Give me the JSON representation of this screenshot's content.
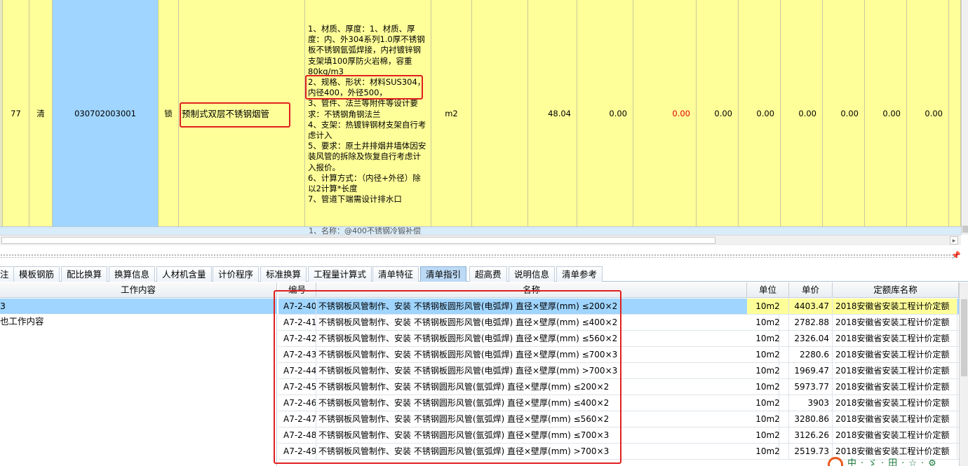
{
  "top_row": {
    "seq": "77",
    "type": "清",
    "code": "030702003001",
    "lock": "锁",
    "name": "预制式双层不锈钢烟管",
    "description": "1、材质、厚度：1、材质、厚度：内、外304系列1.0厚不锈钢板不锈钢氩弧焊接，内衬镀锌钢支架填100厚防火岩棉，容重80kg/m3\n2、规格、形状：材料SUS304，内径400，外径500，\n3、管件、法兰等附件等设计要求：不锈钢角钢法兰\n4、支架：热镀锌钢材支架自行考虑计入\n5、要求：原土井排烟井墙体因安装风管的拆除及恢复自行考虑计入报价。\n6、计算方式：（内径+外径）除以2计算*长度\n7、管道下端需设计排水口",
    "unit": "m2",
    "quantity": "48.04",
    "values": [
      "0.00",
      "0.00",
      "0.00",
      "0.00",
      "0.00",
      "0.00",
      "0.00",
      "0.00"
    ],
    "red_value_color": "#e00000"
  },
  "next_row_peek": "1、名称：@400不锈钢冷锻补偿",
  "tabs": [
    "注",
    "模板钢筋",
    "配比换算",
    "换算信息",
    "人材机含量",
    "计价程序",
    "标准换算",
    "工程量计算式",
    "清单特征",
    "清单指引",
    "超高费",
    "说明信息",
    "清单参考"
  ],
  "active_tab": "清单指引",
  "work_content": {
    "header": "工作内容",
    "rows": [
      "3",
      "也工作内容"
    ]
  },
  "quota_table": {
    "headers": {
      "code": "编号",
      "name": "名称",
      "unit": "单位",
      "price": "单价",
      "lib": "定额库名称"
    },
    "rows": [
      {
        "code": "A7-2-40",
        "name": "不锈钢板风管制作、安装 不锈钢板圆形风管(电弧焊) 直径×壁厚(mm) ≤200×2",
        "unit": "10m2",
        "price": "4403.47",
        "lib": "2018安徽省安装工程计价定额"
      },
      {
        "code": "A7-2-41",
        "name": "不锈钢板风管制作、安装 不锈钢板圆形风管(电弧焊) 直径×壁厚(mm) ≤400×2",
        "unit": "10m2",
        "price": "2782.88",
        "lib": "2018安徽省安装工程计价定额"
      },
      {
        "code": "A7-2-42",
        "name": "不锈钢板风管制作、安装 不锈钢板圆形风管(电弧焊) 直径×壁厚(mm) ≤560×2",
        "unit": "10m2",
        "price": "2326.04",
        "lib": "2018安徽省安装工程计价定额"
      },
      {
        "code": "A7-2-43",
        "name": "不锈钢板风管制作、安装 不锈钢板圆形风管(电弧焊) 直径×壁厚(mm) ≤700×3",
        "unit": "10m2",
        "price": "2280.6",
        "lib": "2018安徽省安装工程计价定额"
      },
      {
        "code": "A7-2-44",
        "name": "不锈钢板风管制作、安装 不锈钢板圆形风管(电弧焊) 直径×壁厚(mm) >700×3",
        "unit": "10m2",
        "price": "1969.47",
        "lib": "2018安徽省安装工程计价定额"
      },
      {
        "code": "A7-2-45",
        "name": "不锈钢板风管制作、安装 不锈钢圆形风管(氩弧焊) 直径×壁厚(mm) ≤200×2",
        "unit": "10m2",
        "price": "5973.77",
        "lib": "2018安徽省安装工程计价定额"
      },
      {
        "code": "A7-2-46",
        "name": "不锈钢板风管制作、安装 不锈钢圆形风管(氩弧焊) 直径×壁厚(mm) ≤400×2",
        "unit": "10m2",
        "price": "3903",
        "lib": "2018安徽省安装工程计价定额"
      },
      {
        "code": "A7-2-47",
        "name": "不锈钢板风管制作、安装 不锈钢圆形风管(氩弧焊) 直径×壁厚(mm) ≤560×2",
        "unit": "10m2",
        "price": "3280.86",
        "lib": "2018安徽省安装工程计价定额"
      },
      {
        "code": "A7-2-48",
        "name": "不锈钢板风管制作、安装 不锈钢圆形风管(氩弧焊) 直径×壁厚(mm) ≤700×3",
        "unit": "10m2",
        "price": "3126.26",
        "lib": "2018安徽省安装工程计价定额"
      },
      {
        "code": "A7-2-49",
        "name": "不锈钢板风管制作、安装 不锈钢圆形风管(氩弧焊) 直径×壁厚(mm) >700×3",
        "unit": "10m2",
        "price": "2519.73",
        "lib": "2018安徽省安装工程计价定额"
      }
    ]
  },
  "tray_text": "中·ゞ·田·☆·⚙",
  "colors": {
    "highlight_box": "#e02020",
    "selected_row": "#9fd5ff",
    "grid_yellow": "#ffff99"
  }
}
